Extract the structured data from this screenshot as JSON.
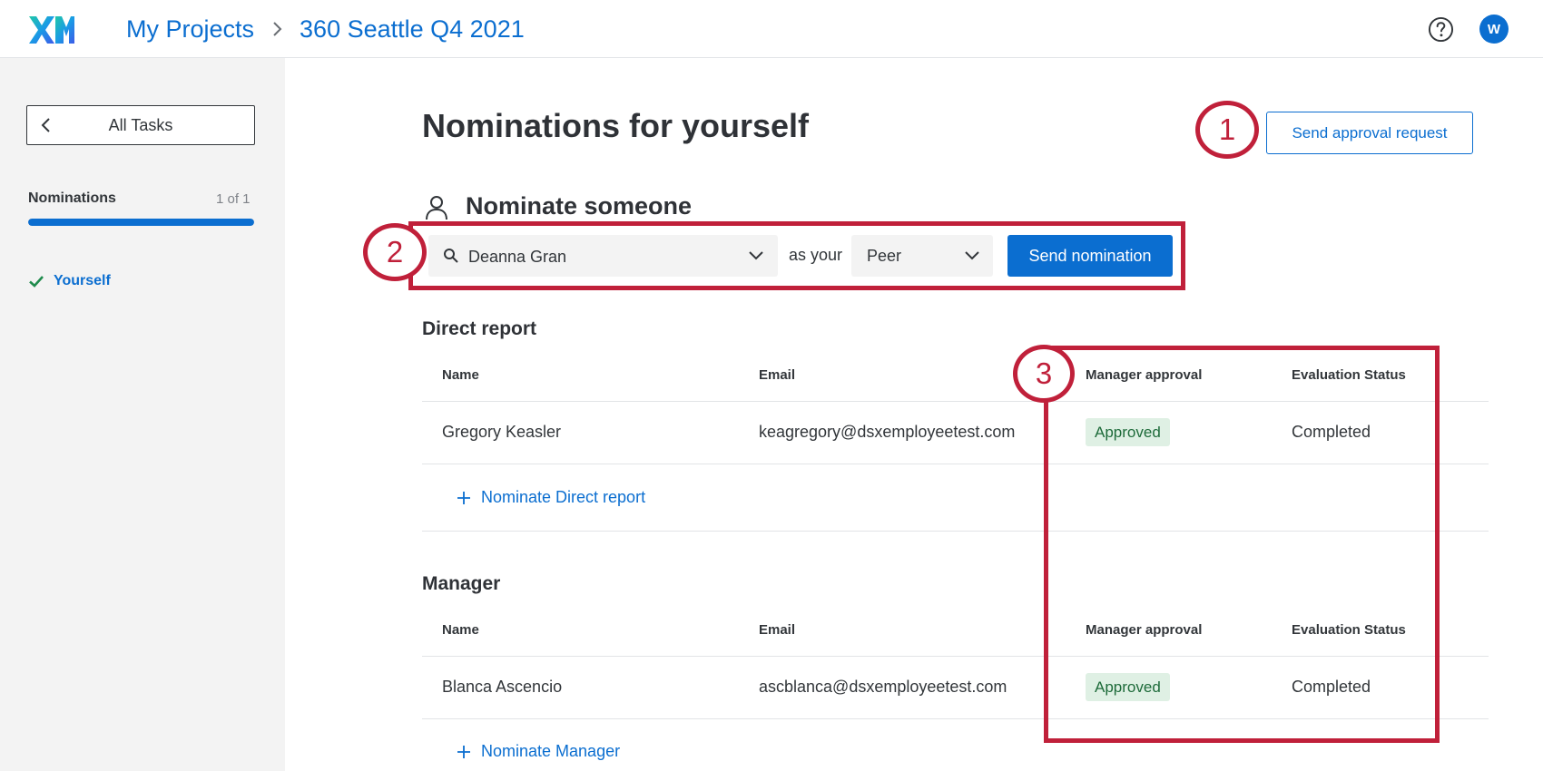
{
  "header": {
    "logo_text": "XM",
    "breadcrumb": [
      "My Projects",
      "360 Seattle Q4 2021"
    ],
    "help_icon": "help-circle-icon",
    "avatar_initial": "W"
  },
  "sidebar": {
    "back_label": "All Tasks",
    "section_title": "Nominations",
    "section_count": "1 of 1",
    "progress": 1.0,
    "items": [
      {
        "label": "Yourself",
        "status": "complete",
        "icon": "check-icon"
      }
    ]
  },
  "main": {
    "title": "Nominations for yourself",
    "approval_button": "Send approval request",
    "nominate": {
      "heading": "Nominate someone",
      "search_value": "Deanna Gran",
      "connector": "as your",
      "role_value": "Peer",
      "send_button": "Send nomination"
    },
    "sections": [
      {
        "heading": "Direct report",
        "columns": [
          "Name",
          "Email",
          "Manager approval",
          "Evaluation Status"
        ],
        "rows": [
          {
            "name": "Gregory Keasler",
            "email": "keagregory@dsxemployeetest.com",
            "approval": "Approved",
            "status": "Completed"
          }
        ],
        "add_label": "Nominate Direct report"
      },
      {
        "heading": "Manager",
        "columns": [
          "Name",
          "Email",
          "Manager approval",
          "Evaluation Status"
        ],
        "rows": [
          {
            "name": "Blanca Ascencio",
            "email": "ascblanca@dsxemployeetest.com",
            "approval": "Approved",
            "status": "Completed"
          }
        ],
        "add_label": "Nominate Manager"
      }
    ]
  },
  "annotations": [
    "1",
    "2",
    "3"
  ],
  "colors": {
    "accent": "#0b6ed0",
    "annotation": "#c0203a",
    "approved_bg": "#dff0e4",
    "approved_text": "#1e6b3a",
    "sidebar_bg": "#f3f3f3"
  }
}
